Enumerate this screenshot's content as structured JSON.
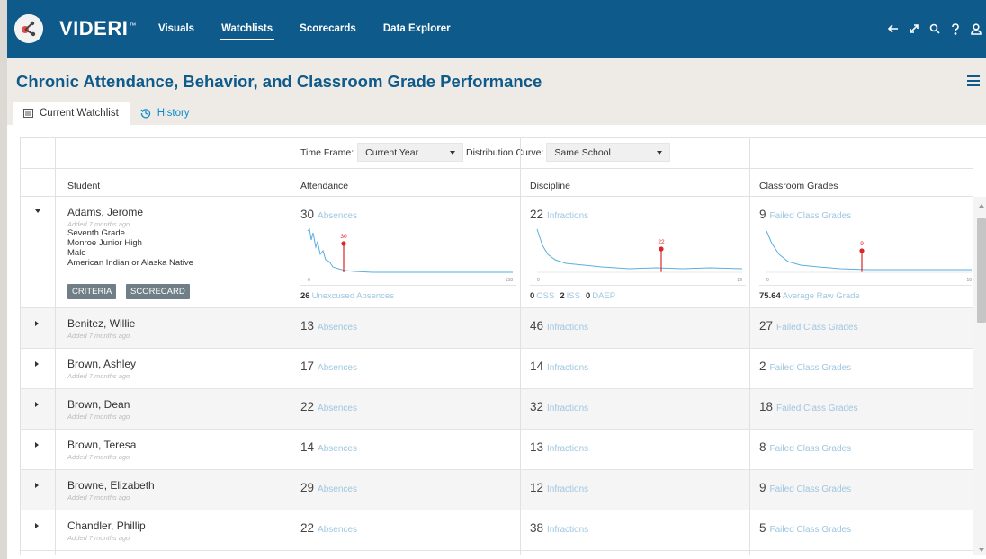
{
  "app": {
    "brand": "VIDERI",
    "trademark": "™",
    "nav": [
      "Visuals",
      "Watchlists",
      "Scorecards",
      "Data Explorer"
    ],
    "active_nav": "Watchlists",
    "icons": [
      "back-arrow-icon",
      "expand-icon",
      "search-icon",
      "help-icon",
      "user-icon"
    ],
    "primary_color": "#0e5a8a"
  },
  "page": {
    "title": "Chronic Attendance, Behavior, and Classroom Grade Performance",
    "tabs": [
      {
        "label": "Current Watchlist",
        "icon": "list-icon",
        "active": true
      },
      {
        "label": "History",
        "icon": "history-icon",
        "active": false
      }
    ]
  },
  "filters": {
    "time_frame_label": "Time Frame:",
    "time_frame_value": "Current Year",
    "distribution_label": "Distribution Curve:",
    "distribution_value": "Same School"
  },
  "columns": {
    "student": "Student",
    "attendance": "Attendance",
    "discipline": "Discipline",
    "grades": "Classroom Grades"
  },
  "labels": {
    "absences": "Absences",
    "infractions": "Infractions",
    "failed_grades": "Failed Class Grades",
    "unexcused": "Unexcused Absences",
    "oss": "OSS",
    "iss": "ISS",
    "daep": "DAEP",
    "avg_raw_grade": "Average Raw Grade",
    "criteria_btn": "CRITERIA",
    "scorecard_btn": "SCORECARD"
  },
  "expanded": {
    "grade": "Seventh Grade",
    "school": "Monroe Junior High",
    "gender": "Male",
    "ethnicity": "American Indian or Alaska Native",
    "unexcused": "26",
    "oss": "0",
    "iss": "2",
    "daep": "0",
    "avg_raw_grade": "75.64",
    "att_chart": {
      "marker": "30",
      "x_min": "0",
      "x_max": "158"
    },
    "dis_chart": {
      "marker": "22",
      "x_min": "0",
      "x_max": "29"
    },
    "grd_chart": {
      "marker": "9",
      "x_min": "0",
      "x_max": "10"
    }
  },
  "students": [
    {
      "name": "Adams, Jerome",
      "added": "Added 7 months ago",
      "absences": "30",
      "infractions": "22",
      "failed": "9"
    },
    {
      "name": "Benitez, Willie",
      "added": "Added 7 months ago",
      "absences": "13",
      "infractions": "46",
      "failed": "27"
    },
    {
      "name": "Brown, Ashley",
      "added": "Added 7 months ago",
      "absences": "17",
      "infractions": "14",
      "failed": "2"
    },
    {
      "name": "Brown, Dean",
      "added": "Added 7 months ago",
      "absences": "22",
      "infractions": "32",
      "failed": "18"
    },
    {
      "name": "Brown, Teresa",
      "added": "Added 7 months ago",
      "absences": "14",
      "infractions": "13",
      "failed": "8"
    },
    {
      "name": "Browne, Elizabeth",
      "added": "Added 7 months ago",
      "absences": "29",
      "infractions": "12",
      "failed": "9"
    },
    {
      "name": "Chandler, Phillip",
      "added": "Added 7 months ago",
      "absences": "22",
      "infractions": "38",
      "failed": "5"
    }
  ]
}
